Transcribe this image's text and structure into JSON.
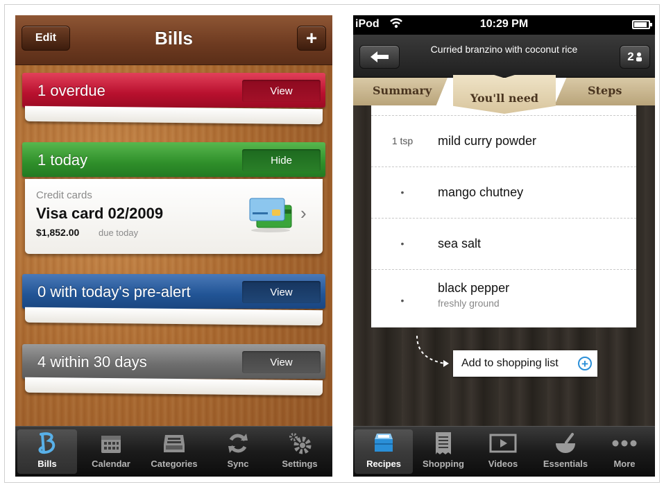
{
  "bills_app": {
    "nav": {
      "title": "Bills",
      "edit_label": "Edit",
      "add_label": "+"
    },
    "sections": [
      {
        "label": "1 overdue",
        "action": "View",
        "color": "#c0152f"
      },
      {
        "label": "1 today",
        "action": "Hide",
        "color": "#339a2c"
      },
      {
        "label": "0 with today's pre-alert",
        "action": "View",
        "color": "#2a5b9d"
      },
      {
        "label": "4 within 30 days",
        "action": "View",
        "color": "#767676"
      }
    ],
    "bill": {
      "category": "Credit cards",
      "name": "Visa card 02/2009",
      "amount": "$1,852.00",
      "due": "due today",
      "icon": "credit-cards-icon"
    },
    "tabbar": [
      {
        "label": "Bills",
        "icon": "bills-icon",
        "active": true
      },
      {
        "label": "Calendar",
        "icon": "calendar-icon"
      },
      {
        "label": "Categories",
        "icon": "inbox-icon"
      },
      {
        "label": "Sync",
        "icon": "sync-icon"
      },
      {
        "label": "Settings",
        "icon": "gear-icon"
      }
    ]
  },
  "recipe_app": {
    "status": {
      "carrier": "iPod",
      "time": "10:29 PM"
    },
    "nav": {
      "title": "Curried branzino with coconut rice",
      "serves": "2"
    },
    "tabs": {
      "summary": "Summary",
      "need": "You'll need",
      "steps": "Steps"
    },
    "ingredients": [
      {
        "qty": "1 tsp",
        "name": "mild curry powder",
        "note": ""
      },
      {
        "qty": "•",
        "name": "mango chutney",
        "note": ""
      },
      {
        "qty": "•",
        "name": "sea salt",
        "note": ""
      },
      {
        "qty": "•",
        "name": "black pepper",
        "note": "freshly ground"
      }
    ],
    "shopping_button": "Add to shopping list",
    "tabbar": [
      {
        "label": "Recipes",
        "icon": "recipes-icon",
        "active": true
      },
      {
        "label": "Shopping",
        "icon": "receipt-icon"
      },
      {
        "label": "Videos",
        "icon": "video-icon"
      },
      {
        "label": "Essentials",
        "icon": "mortar-pestle-icon"
      },
      {
        "label": "More",
        "icon": "more-icon"
      }
    ],
    "accent": "#2a8fd8"
  }
}
